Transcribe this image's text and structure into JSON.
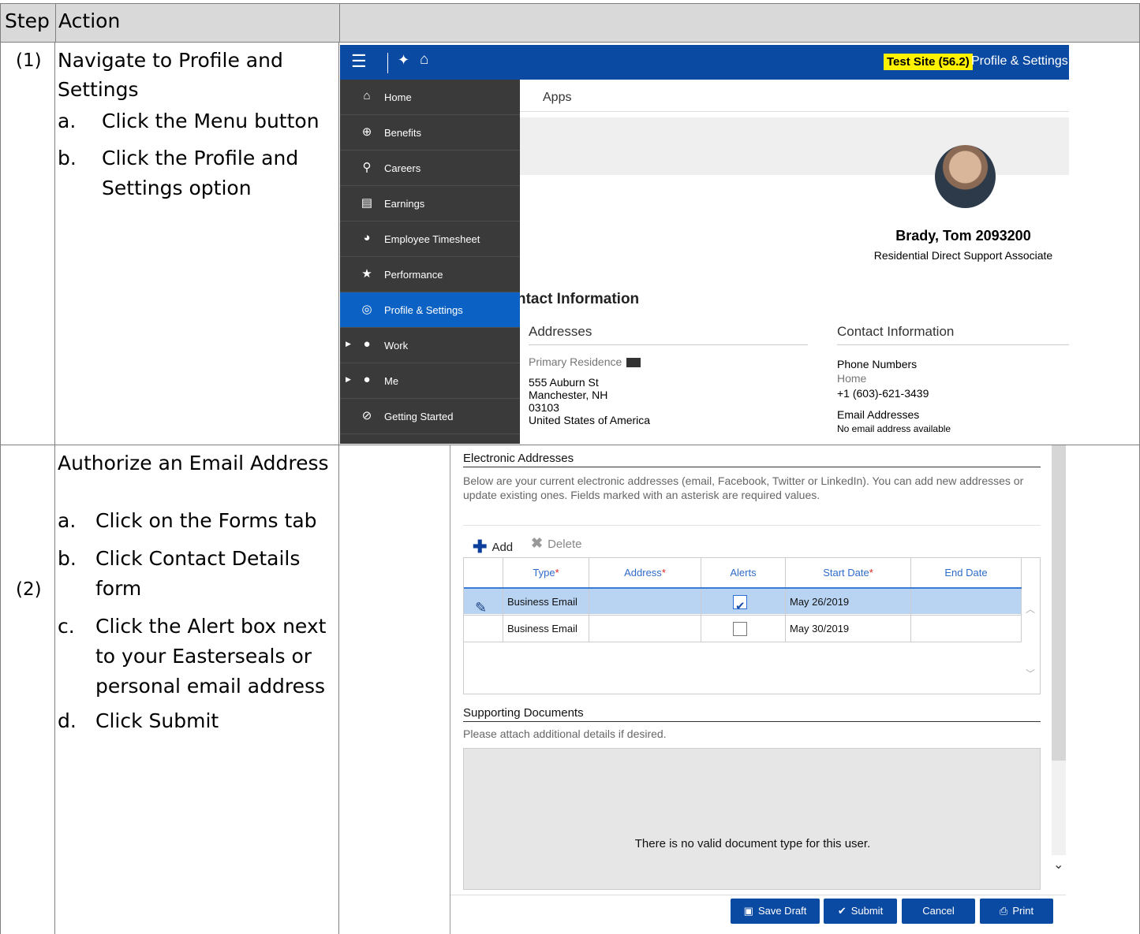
{
  "table": {
    "header": {
      "step": "Step",
      "action": "Action"
    },
    "rows": [
      {
        "step": "(1)",
        "title_line1": "Navigate to Profile and",
        "title_line2": "Settings",
        "items": [
          {
            "label": "a.",
            "text_line1": "Click the Menu button",
            "text_line2": ""
          },
          {
            "label": "b.",
            "text_line1": "Click the Profile and",
            "text_line2": "Settings option"
          }
        ]
      },
      {
        "step": "(2)",
        "title_line1": "Authorize an Email Address",
        "items": [
          {
            "label": "a.",
            "text_line1": "Click on the Forms tab"
          },
          {
            "label": "b.",
            "text_line1": "Click Contact Details",
            "text_line2": "form"
          },
          {
            "label": "c.",
            "text_line1": "Click the Alert box next",
            "text_line2": "to your Easterseals or",
            "text_line3": "personal email address"
          },
          {
            "label": "d.",
            "text_line1": "Click Submit"
          }
        ]
      }
    ]
  },
  "screenshot1": {
    "site_badge": "Test Site (56.2)",
    "page_title": "Profile & Settings",
    "menu": [
      {
        "label": "Home",
        "icon": "home-icon"
      },
      {
        "label": "Benefits",
        "icon": "plus-circle-icon"
      },
      {
        "label": "Careers",
        "icon": "search-people-icon"
      },
      {
        "label": "Earnings",
        "icon": "earnings-icon"
      },
      {
        "label": "Employee Timesheet",
        "icon": "timesheet-person-icon"
      },
      {
        "label": "Performance",
        "icon": "star-icon"
      },
      {
        "label": "Profile & Settings",
        "icon": "profile-gear-icon"
      },
      {
        "label": "Work",
        "icon": "people-icon"
      },
      {
        "label": "Me",
        "icon": "person-icon"
      },
      {
        "label": "Getting Started",
        "icon": "compass-icon"
      }
    ],
    "apps_tab": "Apps",
    "person_name": "Brady, Tom 2093200",
    "person_title": "Residential Direct Support Associate",
    "contact_heading": "ntact Information",
    "addresses_heading": "Addresses",
    "primary_residence": "Primary Residence",
    "address_line1": "555 Auburn St",
    "address_line2": "Manchester, NH",
    "address_line3": "03103",
    "address_line4": "United States of America",
    "contact_info_heading": "Contact Information",
    "phone_numbers_label": "Phone Numbers",
    "phone_type": "Home",
    "phone_number": "+1 (603)-621-3439",
    "email_label": "Email Addresses",
    "email_value": "No email address available"
  },
  "screenshot2": {
    "section_title": "Electronic Addresses",
    "description": "Below are your current electronic addresses (email, Facebook, Twitter or LinkedIn). You can add new addresses or update existing ones. Fields marked with an asterisk are required values.",
    "add_label": "Add",
    "delete_label": "Delete",
    "columns": {
      "type": "Type",
      "address": "Address",
      "alerts": "Alerts",
      "start_date": "Start Date",
      "end_date": "End Date",
      "required_mark": "*"
    },
    "rows": [
      {
        "type": "Business Email",
        "address": "",
        "alert": true,
        "start_date": "May 26/2019",
        "end_date": ""
      },
      {
        "type": "Business Email",
        "address": "",
        "alert": false,
        "start_date": "May 30/2019",
        "end_date": ""
      }
    ],
    "docs_title": "Supporting Documents",
    "docs_desc": "Please attach additional details if desired.",
    "docs_message": "There is no valid document type for this user.",
    "buttons": {
      "save_draft": "Save Draft",
      "submit": "Submit",
      "cancel": "Cancel",
      "print": "Print"
    }
  }
}
